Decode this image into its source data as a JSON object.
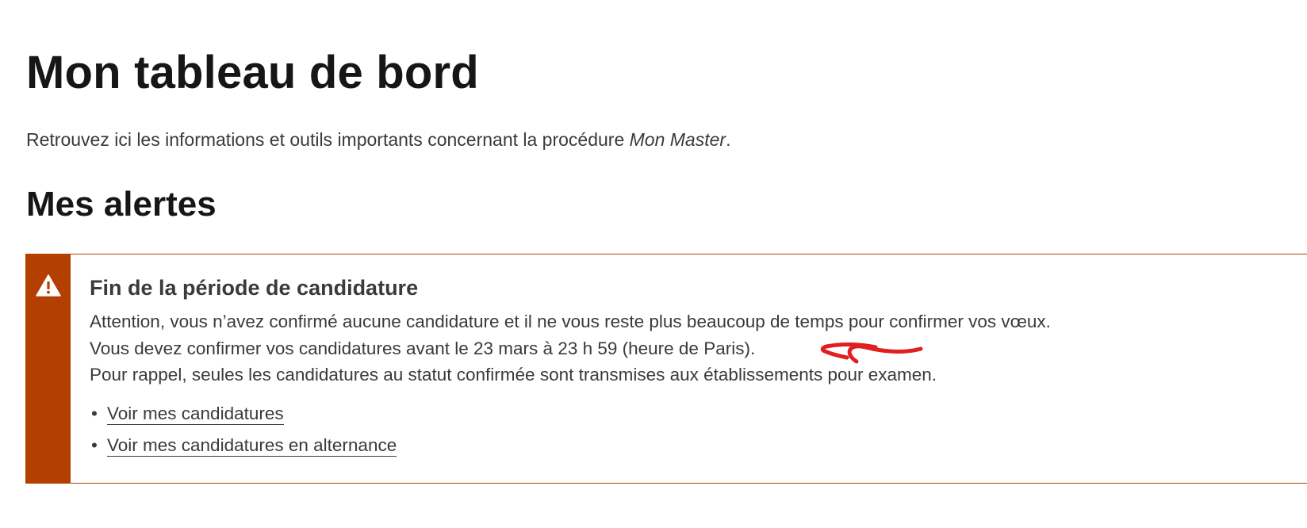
{
  "page": {
    "title": "Mon tableau de bord",
    "intro_text": "Retrouvez ici les informations et outils importants concernant la procédure ",
    "intro_emphasis": "Mon Master",
    "intro_end": "."
  },
  "alerts_section": {
    "title": "Mes alertes"
  },
  "alert": {
    "icon": "warning-icon",
    "accent_color": "#b34000",
    "title": "Fin de la période de candidature",
    "lines": [
      "Attention, vous n’avez confirmé aucune candidature et il ne vous reste plus beaucoup de temps pour confirmer vos vœux.",
      "Vous devez confirmer vos candidatures avant le 23 mars à 23 h 59 (heure de Paris).",
      "Pour rappel, seules les candidatures au statut confirmée sont transmises aux établissements pour examen."
    ],
    "links": [
      {
        "label": "Voir mes candidatures"
      },
      {
        "label": "Voir mes candidatures en alternance"
      }
    ]
  },
  "annotation": {
    "icon": "hand-drawn-arrow-icon",
    "color": "#e02020"
  }
}
